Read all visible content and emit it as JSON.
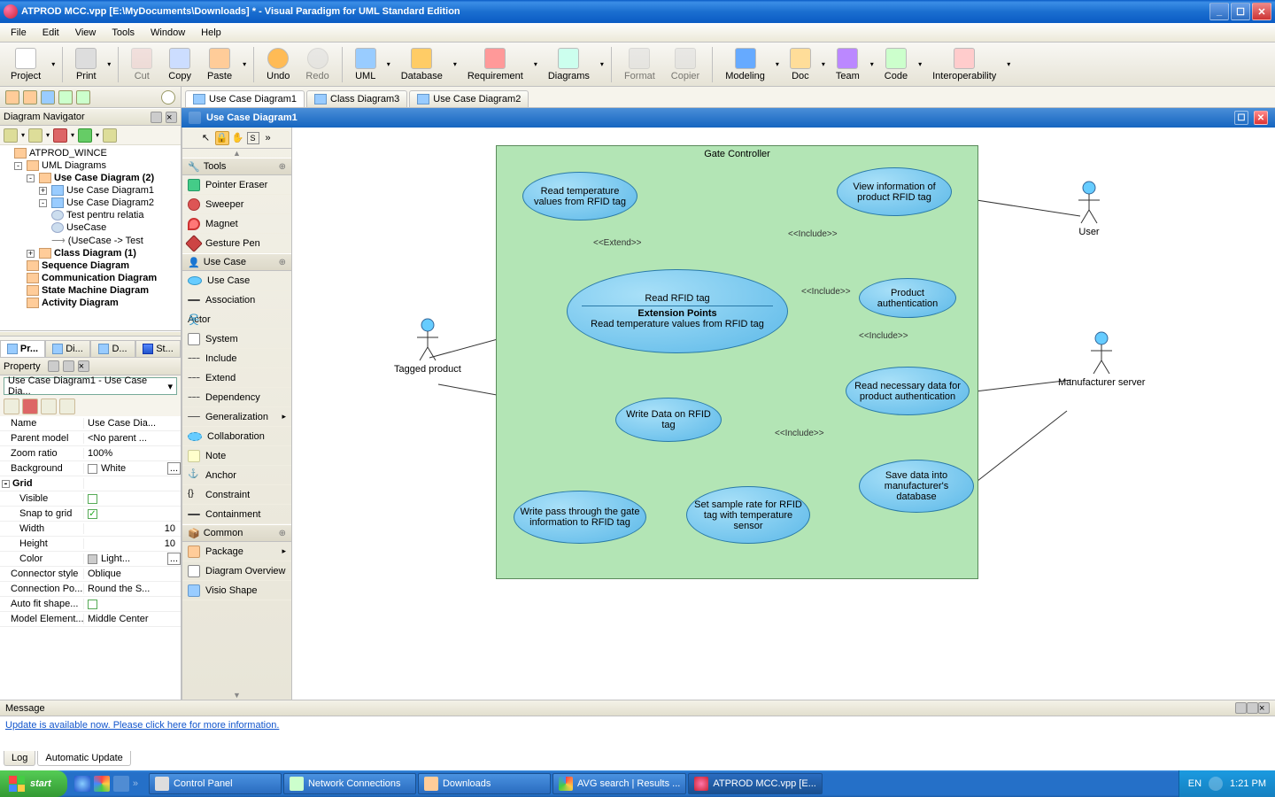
{
  "title": "ATPROD MCC.vpp [E:\\MyDocuments\\Downloads] * - Visual Paradigm for UML Standard Edition",
  "menu": {
    "file": "File",
    "edit": "Edit",
    "view": "View",
    "tools": "Tools",
    "window": "Window",
    "help": "Help"
  },
  "toolbar": {
    "project": "Project",
    "print": "Print",
    "cut": "Cut",
    "copy": "Copy",
    "paste": "Paste",
    "undo": "Undo",
    "redo": "Redo",
    "uml": "UML",
    "database": "Database",
    "requirement": "Requirement",
    "diagrams": "Diagrams",
    "format": "Format",
    "copier": "Copier",
    "modeling": "Modeling",
    "doc": "Doc",
    "team": "Team",
    "code": "Code",
    "interop": "Interoperability"
  },
  "tabs": [
    {
      "label": "Use Case Diagram1",
      "active": true
    },
    {
      "label": "Class Diagram3",
      "active": false
    },
    {
      "label": "Use Case Diagram2",
      "active": false
    }
  ],
  "canvas_title": "Use Case Diagram1",
  "navigator": {
    "title": "Diagram Navigator",
    "root": "ATPROD_WINCE",
    "uml": "UML Diagrams",
    "ucd_group": "Use Case Diagram (2)",
    "ucd1": "Use Case Diagram1",
    "ucd2": "Use Case Diagram2",
    "node_test": "Test pentru relatia",
    "node_uc": "UseCase",
    "node_rel": "(UseCase -> Test",
    "cd_group": "Class Diagram (1)",
    "seq": "Sequence Diagram",
    "comm": "Communication Diagram",
    "state": "State Machine Diagram",
    "act": "Activity Diagram"
  },
  "proptabs": {
    "p": "Pr...",
    "d": "Di...",
    "d2": "D...",
    "s": "St..."
  },
  "property": {
    "title": "Property",
    "combo": "Use Case Diagram1 - Use Case Dia...",
    "rows": {
      "name_k": "Name",
      "name_v": "Use Case Dia...",
      "parent_k": "Parent model",
      "parent_v": "<No parent ...",
      "zoom_k": "Zoom ratio",
      "zoom_v": "100%",
      "bg_k": "Background",
      "bg_v": "White",
      "grid_k": "Grid",
      "vis_k": "Visible",
      "snap_k": "Snap to grid",
      "width_k": "Width",
      "width_v": "10",
      "height_k": "Height",
      "height_v": "10",
      "color_k": "Color",
      "color_v": "Light...",
      "conn_k": "Connector style",
      "conn_v": "Oblique",
      "connp_k": "Connection Po...",
      "connp_v": "Round the S...",
      "auto_k": "Auto fit shape...",
      "model_k": "Model Element...",
      "model_v": "Middle Center"
    }
  },
  "palette": {
    "tools_hdr": "Tools",
    "pointer_eraser": "Pointer Eraser",
    "sweeper": "Sweeper",
    "magnet": "Magnet",
    "gesture": "Gesture Pen",
    "uc_hdr": "Use Case",
    "usecase": "Use Case",
    "association": "Association",
    "actor": "Actor",
    "system": "System",
    "include": "Include",
    "extend": "Extend",
    "dependency": "Dependency",
    "generalization": "Generalization",
    "collaboration": "Collaboration",
    "note": "Note",
    "anchor": "Anchor",
    "constraint": "Constraint",
    "containment": "Containment",
    "common_hdr": "Common",
    "package": "Package",
    "overview": "Diagram Overview",
    "visio": "Visio Shape",
    "s": "S"
  },
  "diagram": {
    "system": "Gate Controller",
    "uc_read_temp": "Read temperature values from RFID tag",
    "uc_view_info": "View information of product RFID tag",
    "uc_read_rfid": "Read RFID tag",
    "uc_ext_pts": "Extension Points",
    "uc_ext_line": "Read temperature values from RFID tag",
    "uc_prod_auth": "Product authentication",
    "uc_read_nec": "Read necessary data for product authentication",
    "uc_write_data": "Write Data on RFID tag",
    "uc_write_pass": "Write pass through the gate information to RFID tag",
    "uc_set_sample": "Set sample rate for RFID tag with temperature sensor",
    "uc_save_data": "Save data into manufacturer's database",
    "actor_tagged": "Tagged product",
    "actor_user": "User",
    "actor_manuf": "Manufacturer server",
    "lbl_extend": "<<Extend>>",
    "lbl_include": "<<Include>>"
  },
  "message": {
    "title": "Message",
    "link": "Update is available now. Please click here for more information.",
    "tab_log": "Log",
    "tab_auto": "Automatic Update"
  },
  "taskbar": {
    "start": "start",
    "t1": "Control Panel",
    "t2": "Network Connections",
    "t3": "Downloads",
    "t4": "AVG search | Results ...",
    "t5": "ATPROD MCC.vpp [E...",
    "lang": "EN",
    "time": "1:21 PM"
  }
}
